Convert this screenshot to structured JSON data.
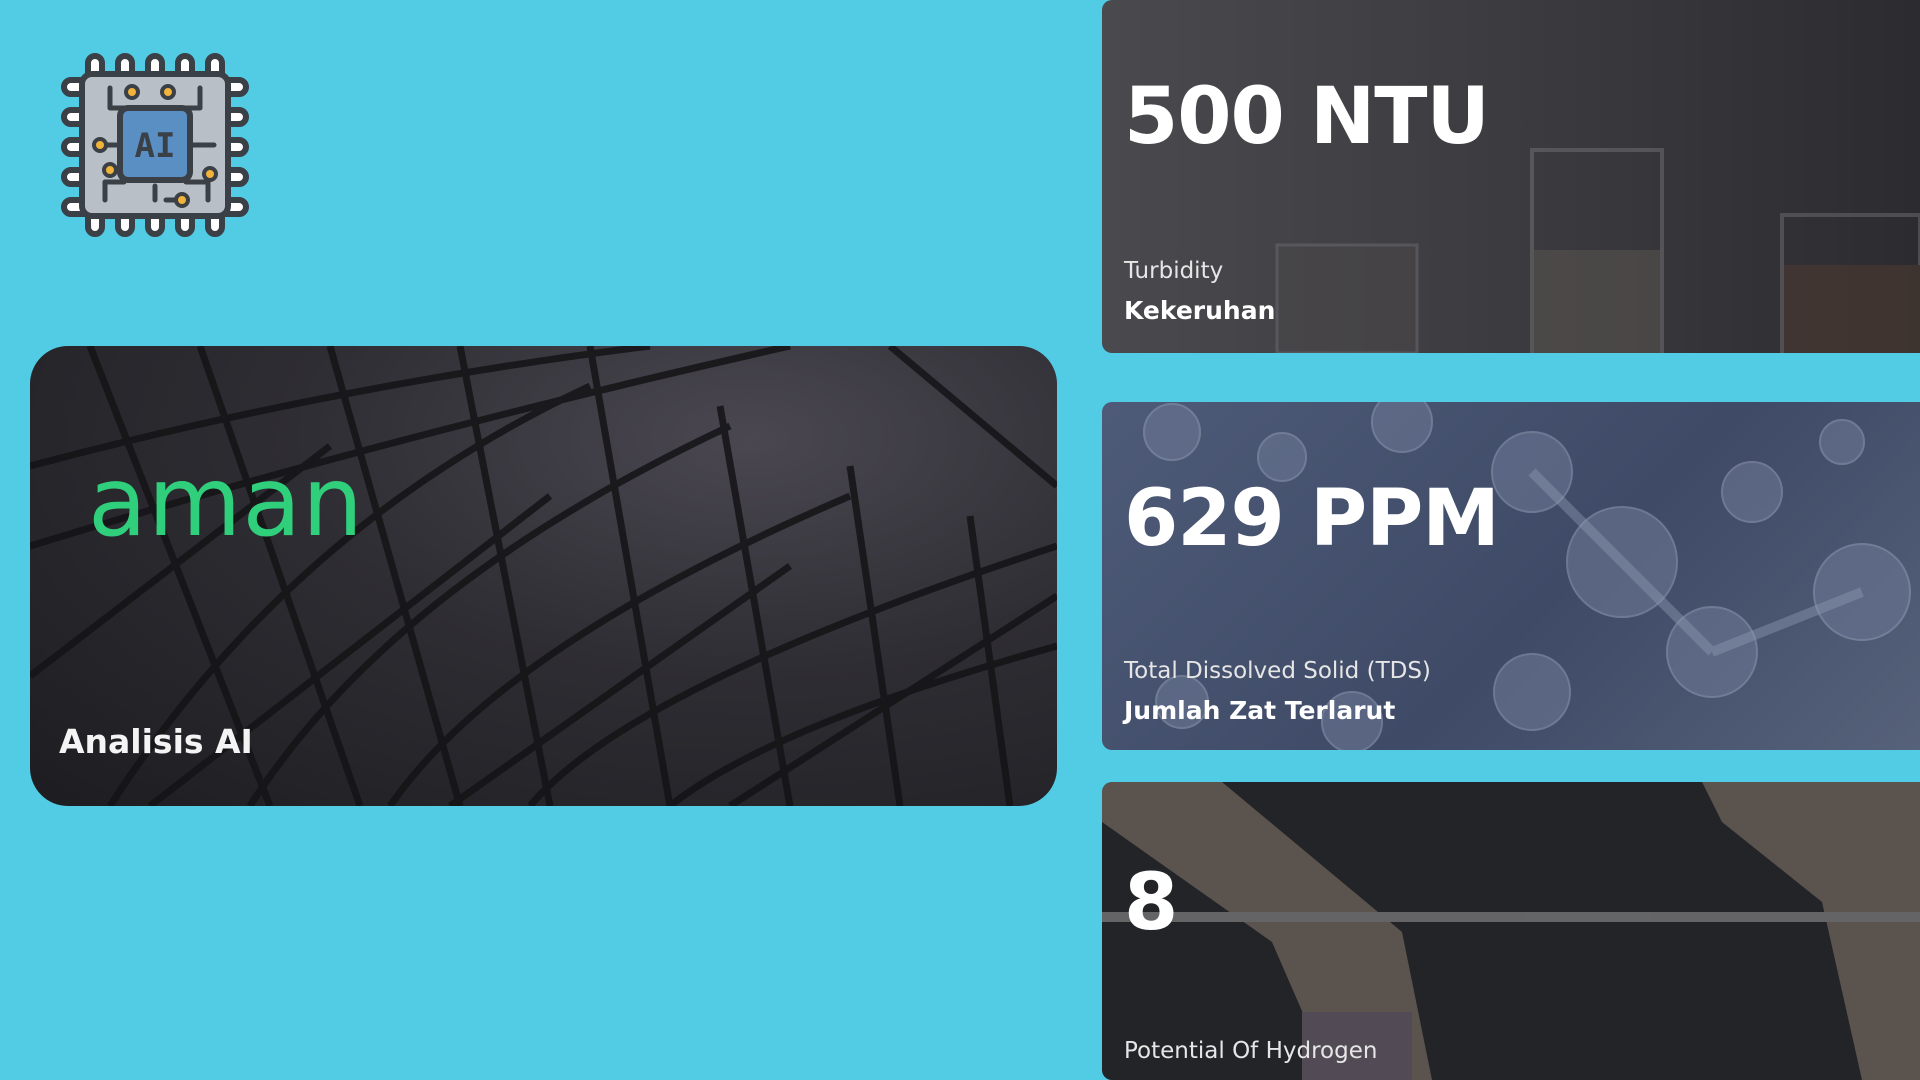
{
  "logo": {
    "icon": "ai-chip-icon",
    "text": "AI"
  },
  "ai_analysis": {
    "status": "aman",
    "label": "Analisis AI",
    "status_color": "#2fcf7c"
  },
  "sensors": {
    "turbidity": {
      "value": "500 NTU",
      "name_en": "Turbidity",
      "name_id": "Kekeruhan"
    },
    "tds": {
      "value": "629 PPM",
      "name_en": "Total Dissolved Solid (TDS)",
      "name_id": "Jumlah Zat Terlarut"
    },
    "ph": {
      "value": "8",
      "name_en": "Potential Of Hydrogen"
    }
  },
  "colors": {
    "background": "#52cbe5",
    "chip_body": "#b9bfc6",
    "chip_core": "#5a8fc4",
    "chip_outline": "#3b3f46",
    "chip_pin_dot": "#f1b33a"
  }
}
